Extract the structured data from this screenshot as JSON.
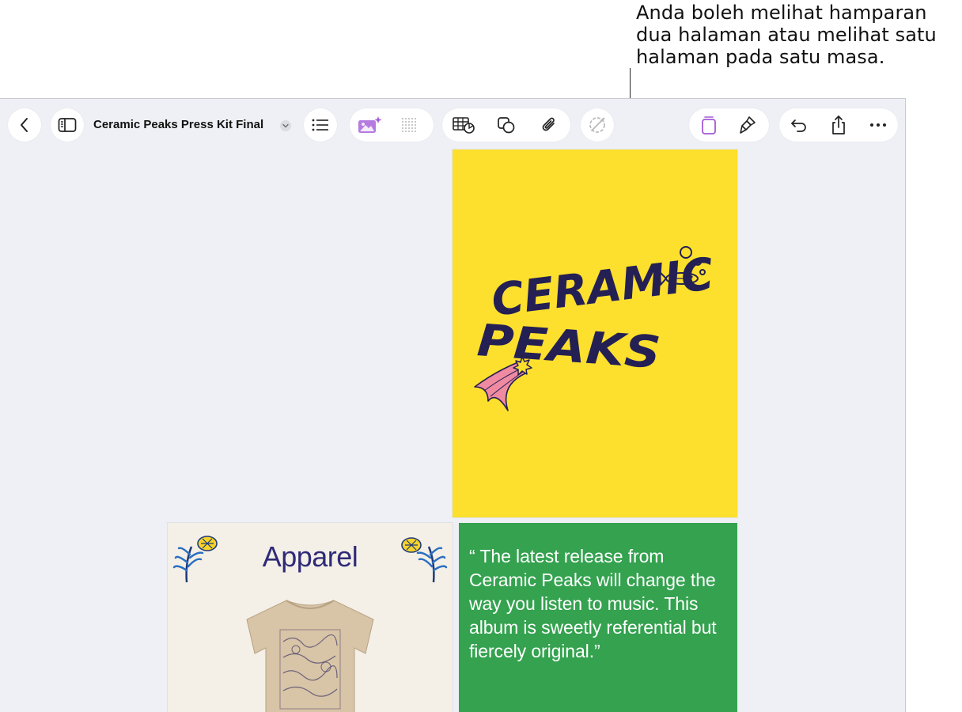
{
  "callout": {
    "text": "Anda boleh melihat hamparan dua halaman atau melihat satu halaman pada satu masa."
  },
  "toolbar": {
    "document_title": "Ceramic Peaks Press Kit Final",
    "icons": [
      "back-icon",
      "sidebar-icon",
      "title-chevron-icon",
      "list-icon",
      "image-playground-icon",
      "grid-icon",
      "table-chart-icon",
      "shapes-icon",
      "attachment-icon",
      "smart-annotation-icon",
      "pages-view-icon",
      "format-brush-icon",
      "undo-icon",
      "share-icon",
      "more-icon"
    ],
    "accent_color": "#a35ad8"
  },
  "document": {
    "cover": {
      "line1": "CERAMIC",
      "line2": "PEAKS",
      "background": "#fde02d",
      "ink": "#242054"
    },
    "apparel": {
      "title": "Apparel",
      "background": "#f4f0e7"
    },
    "quote": {
      "text": "“ The latest release from Ceramic Peaks will change the way you listen to music. This album is sweetly referential but fiercely original.”",
      "background": "#34a24f"
    }
  }
}
